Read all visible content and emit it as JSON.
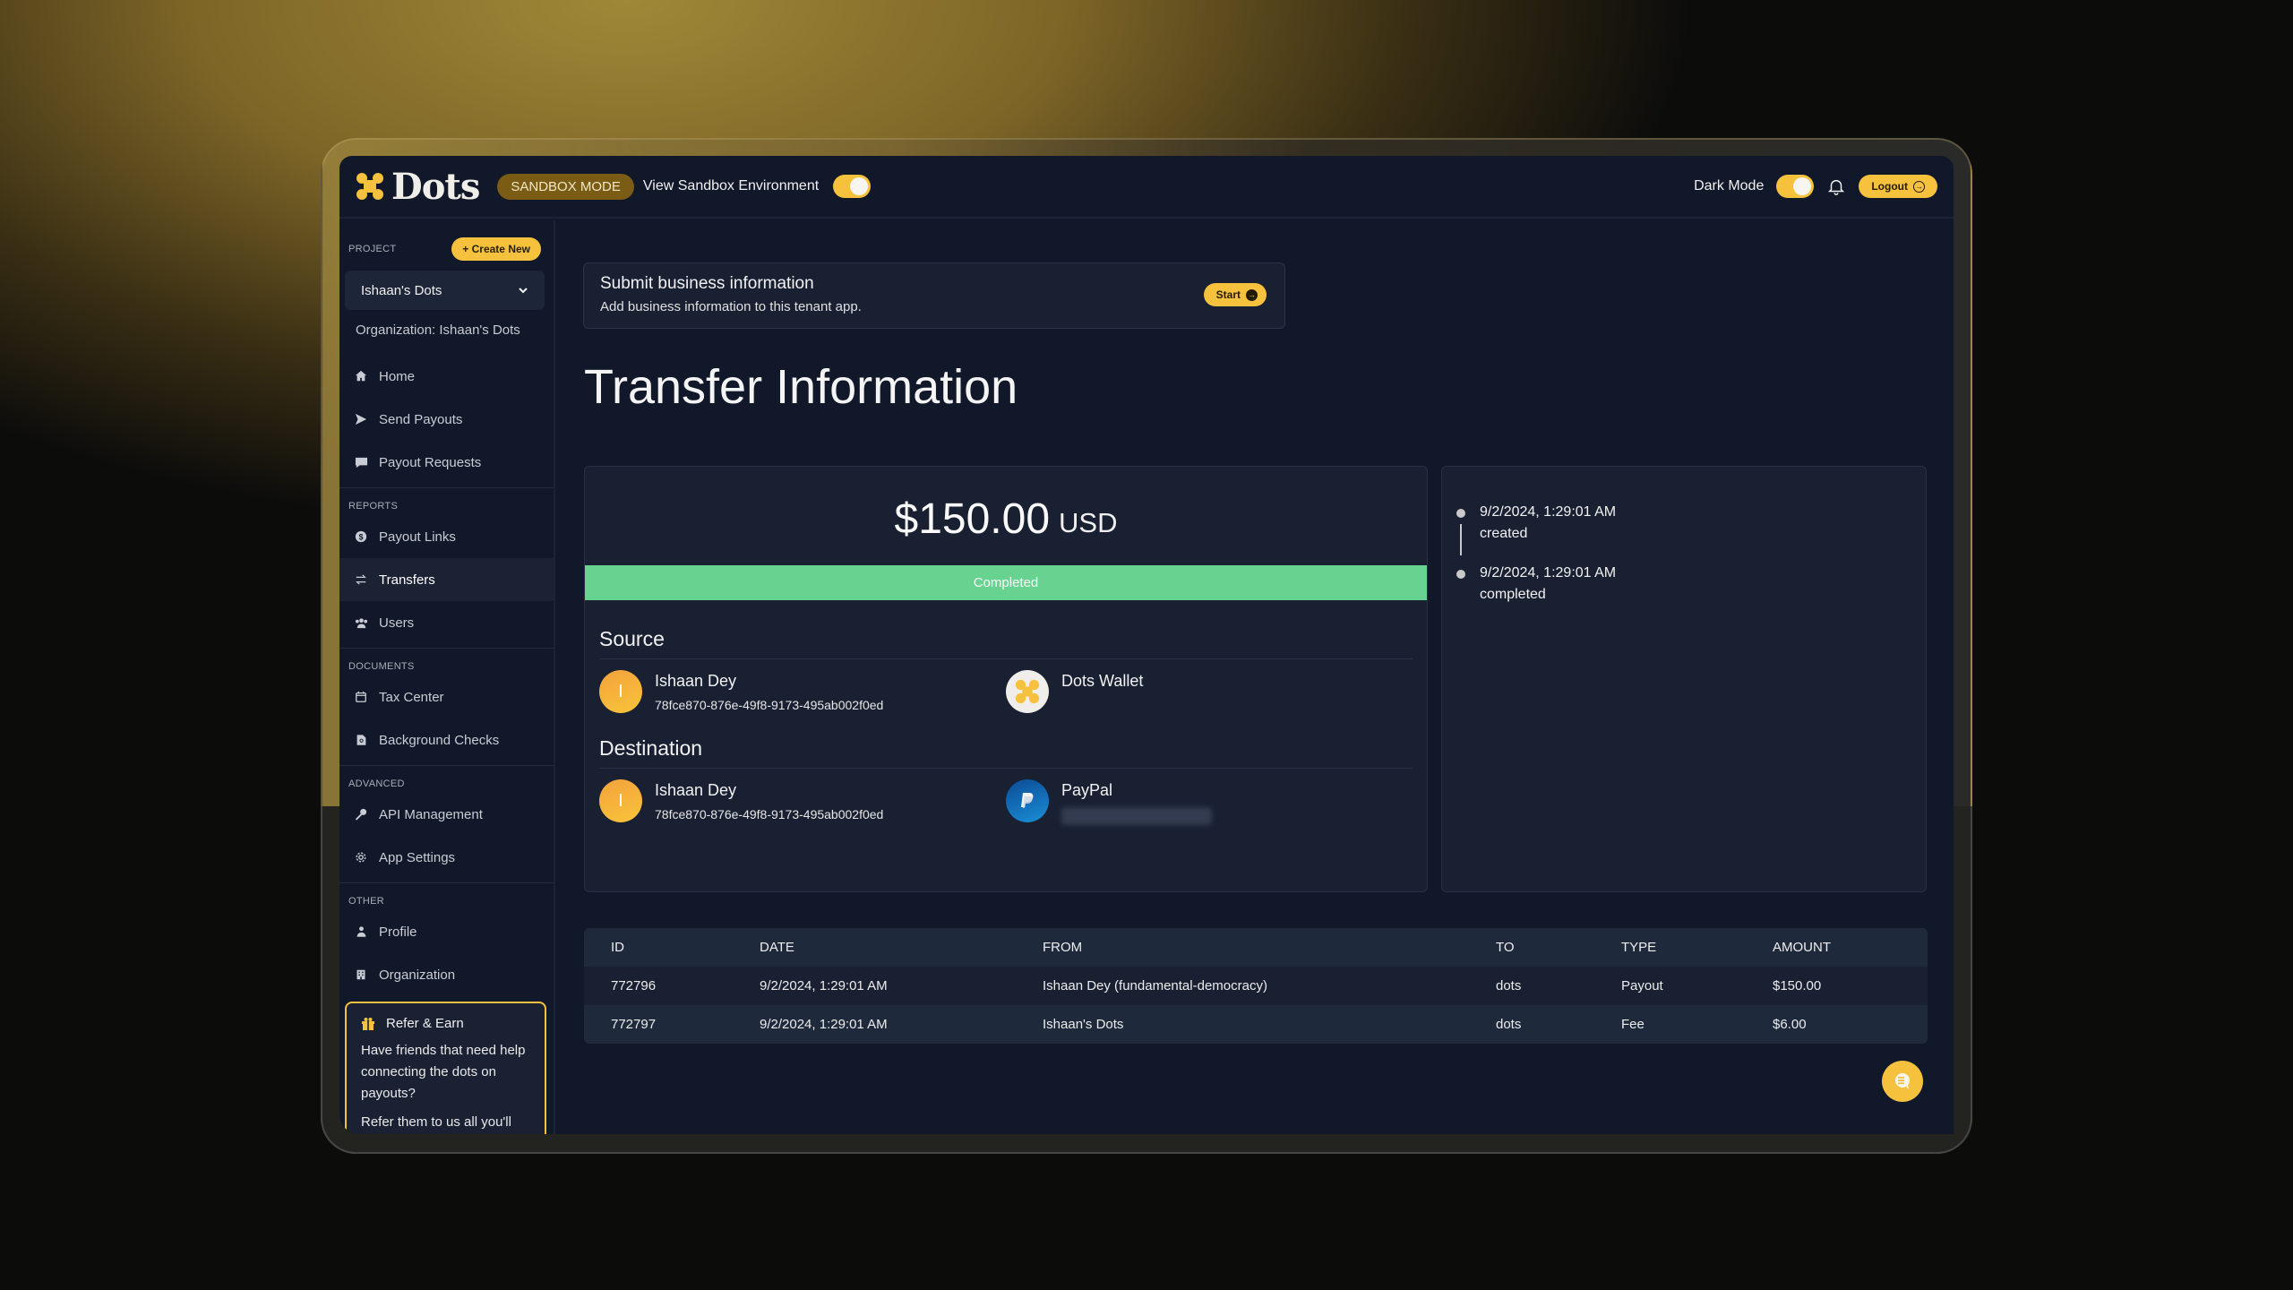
{
  "topbar": {
    "brand": "Dots",
    "sandbox_badge": "SANDBOX MODE",
    "sandbox_toggle_label": "View Sandbox Environment",
    "sandbox_toggle_on": true,
    "dark_mode_label": "Dark Mode",
    "dark_mode_on": true,
    "logout_label": "Logout"
  },
  "sidebar": {
    "project_label": "PROJECT",
    "create_new_label": "Create New",
    "project_selected": "Ishaan's Dots",
    "organization_label": "Organization: Ishaan's Dots",
    "main_items": [
      {
        "label": "Home",
        "icon": "home-icon"
      },
      {
        "label": "Send Payouts",
        "icon": "send-icon"
      },
      {
        "label": "Payout Requests",
        "icon": "chat-bubble-icon"
      }
    ],
    "groups": [
      {
        "label": "REPORTS",
        "items": [
          {
            "label": "Payout Links",
            "icon": "dollar-circle-icon"
          },
          {
            "label": "Transfers",
            "icon": "arrows-swap-icon",
            "active": true
          },
          {
            "label": "Users",
            "icon": "users-icon"
          }
        ]
      },
      {
        "label": "DOCUMENTS",
        "items": [
          {
            "label": "Tax Center",
            "icon": "calendar-icon"
          },
          {
            "label": "Background Checks",
            "icon": "document-search-icon"
          }
        ]
      },
      {
        "label": "ADVANCED",
        "items": [
          {
            "label": "API Management",
            "icon": "key-icon"
          },
          {
            "label": "App Settings",
            "icon": "gear-icon"
          }
        ]
      },
      {
        "label": "OTHER",
        "items": [
          {
            "label": "Profile",
            "icon": "user-icon"
          },
          {
            "label": "Organization",
            "icon": "building-icon"
          }
        ]
      }
    ],
    "refer": {
      "title": "Refer & Earn",
      "body": "Have friends that need help connecting the dots on payouts?",
      "body2": "Refer them to us all you'll"
    }
  },
  "business_banner": {
    "title": "Submit business information",
    "subtitle": "Add business information to this tenant app.",
    "start_label": "Start"
  },
  "page_title": "Transfer Information",
  "transfer": {
    "amount": "$150.00",
    "currency": "USD",
    "status": "Completed",
    "status_color": "#68d391",
    "source": {
      "heading": "Source",
      "user_initial": "I",
      "user_name": "Ishaan Dey",
      "user_id": "78fce870-876e-49f8-9173-495ab002f0ed",
      "method_name": "Dots Wallet"
    },
    "destination": {
      "heading": "Destination",
      "user_initial": "I",
      "user_name": "Ishaan Dey",
      "user_id": "78fce870-876e-49f8-9173-495ab002f0ed",
      "method_name": "PayPal"
    }
  },
  "timeline": [
    {
      "time": "9/2/2024, 1:29:01 AM",
      "event": "created"
    },
    {
      "time": "9/2/2024, 1:29:01 AM",
      "event": "completed"
    }
  ],
  "table": {
    "headers": [
      "ID",
      "DATE",
      "FROM",
      "TO",
      "TYPE",
      "AMOUNT"
    ],
    "rows": [
      [
        "772796",
        "9/2/2024, 1:29:01 AM",
        "Ishaan Dey (fundamental-democracy)",
        "dots",
        "Payout",
        "$150.00"
      ],
      [
        "772797",
        "9/2/2024, 1:29:01 AM",
        "Ishaan's Dots",
        "dots",
        "Fee",
        "$6.00"
      ]
    ]
  },
  "colors": {
    "accent": "#f6c23e",
    "background": "#10182a",
    "card": "#182032",
    "success": "#68d391"
  }
}
